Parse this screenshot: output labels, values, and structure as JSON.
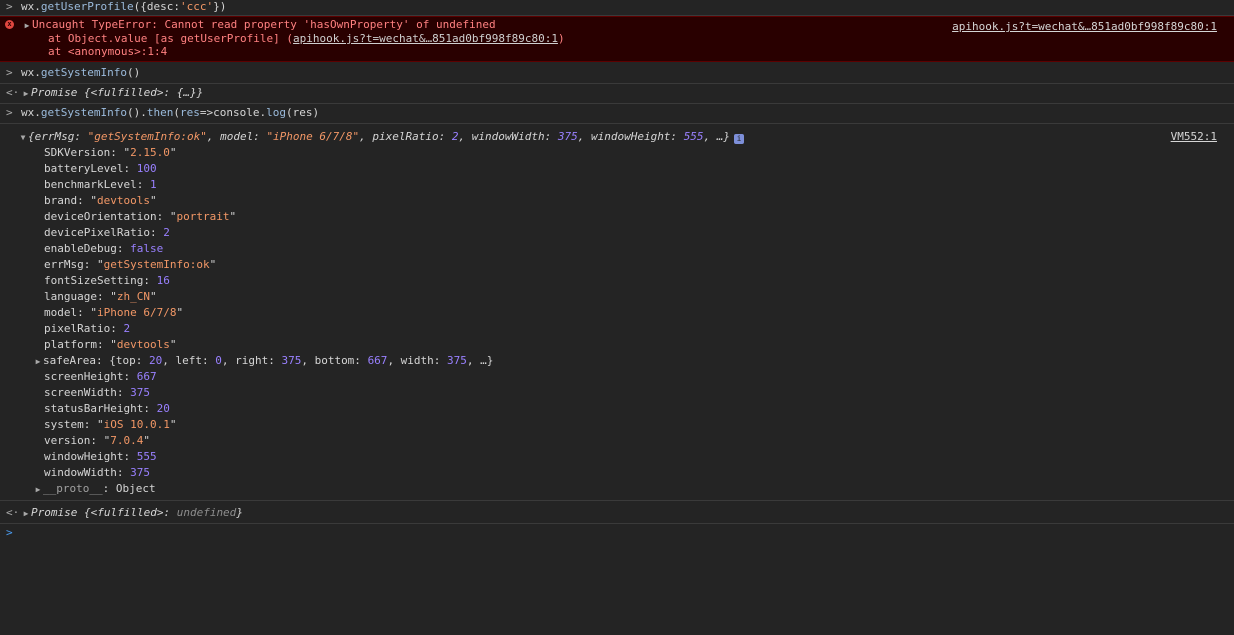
{
  "rows": {
    "r1": {
      "prompt": ">",
      "text_a": "wx.",
      "text_b": "getUserProfile",
      "text_c": "({desc:",
      "text_d": "'ccc'",
      "text_e": "})"
    },
    "err": {
      "icon": "x",
      "msg": "Uncaught TypeError: Cannot read property 'hasOwnProperty' of undefined",
      "stack1_prefix": "at Object.value [as getUserProfile] (",
      "stack1_link": "apihook.js?t=wechat&…851ad0bf998f89c80:1",
      "stack1_suffix": ")",
      "stack2": "at <anonymous>:1:4",
      "source": "apihook.js?t=wechat&…851ad0bf998f89c80:1"
    },
    "r3": {
      "prompt": ">",
      "text_a": "wx.",
      "text_b": "getSystemInfo",
      "text_c": "()"
    },
    "r4": {
      "prompt": "<·",
      "text": "Promise {<fulfilled>: {…}}"
    },
    "r5": {
      "prompt": ">",
      "a": "wx.",
      "b": "getSystemInfo",
      "c": "().",
      "d": "then",
      "e": "(",
      "f": "res",
      "g": "=>console.",
      "h": "log",
      "i": "(res)"
    },
    "obj": {
      "head_prefix": "{errMsg: ",
      "errmsg": "\"getSystemInfo:ok\"",
      "model_k": ", model: ",
      "model_v": "\"iPhone 6/7/8\"",
      "pr_k": ", pixelRatio: ",
      "pr_v": "2",
      "ww_k": ", windowWidth: ",
      "ww_v": "375",
      "wh_k": ", windowHeight: ",
      "wh_v": "555",
      "tail": ", …}",
      "info": "i",
      "source": "VM552:1"
    },
    "props": [
      {
        "k": "SDKVersion",
        "v": "2.15.0",
        "t": "str"
      },
      {
        "k": "batteryLevel",
        "v": "100",
        "t": "num"
      },
      {
        "k": "benchmarkLevel",
        "v": "1",
        "t": "num"
      },
      {
        "k": "brand",
        "v": "devtools",
        "t": "str"
      },
      {
        "k": "deviceOrientation",
        "v": "portrait",
        "t": "str"
      },
      {
        "k": "devicePixelRatio",
        "v": "2",
        "t": "num"
      },
      {
        "k": "enableDebug",
        "v": "false",
        "t": "num"
      },
      {
        "k": "errMsg",
        "v": "getSystemInfo:ok",
        "t": "str"
      },
      {
        "k": "fontSizeSetting",
        "v": "16",
        "t": "num"
      },
      {
        "k": "language",
        "v": "zh_CN",
        "t": "str"
      },
      {
        "k": "model",
        "v": "iPhone 6/7/8",
        "t": "str"
      },
      {
        "k": "pixelRatio",
        "v": "2",
        "t": "num"
      },
      {
        "k": "platform",
        "v": "devtools",
        "t": "str"
      }
    ],
    "safeArea": {
      "k": "safeArea",
      "pre": "{top: ",
      "top": "20",
      "l_k": ", left: ",
      "l": "0",
      "r_k": ", right: ",
      "r": "375",
      "b_k": ", bottom: ",
      "b": "667",
      "w_k": ", width: ",
      "w": "375",
      "tail": ", …}"
    },
    "props2": [
      {
        "k": "screenHeight",
        "v": "667",
        "t": "num"
      },
      {
        "k": "screenWidth",
        "v": "375",
        "t": "num"
      },
      {
        "k": "statusBarHeight",
        "v": "20",
        "t": "num"
      },
      {
        "k": "system",
        "v": "iOS 10.0.1",
        "t": "str"
      },
      {
        "k": "version",
        "v": "7.0.4",
        "t": "str"
      },
      {
        "k": "windowHeight",
        "v": "555",
        "t": "num"
      },
      {
        "k": "windowWidth",
        "v": "375",
        "t": "num"
      }
    ],
    "proto": {
      "k": "__proto__",
      "v": "Object"
    },
    "r_last": {
      "prompt": "<·",
      "pre": "Promise {<fulfilled>: ",
      "val": "undefined",
      "post": "}"
    },
    "input_prompt": ">"
  },
  "colors": {
    "background": "#242424",
    "string": "#f29766",
    "number": "#9980ff",
    "error_bg": "#290000",
    "error_text": "#ff8080",
    "prompt": "#4a9cf1"
  }
}
